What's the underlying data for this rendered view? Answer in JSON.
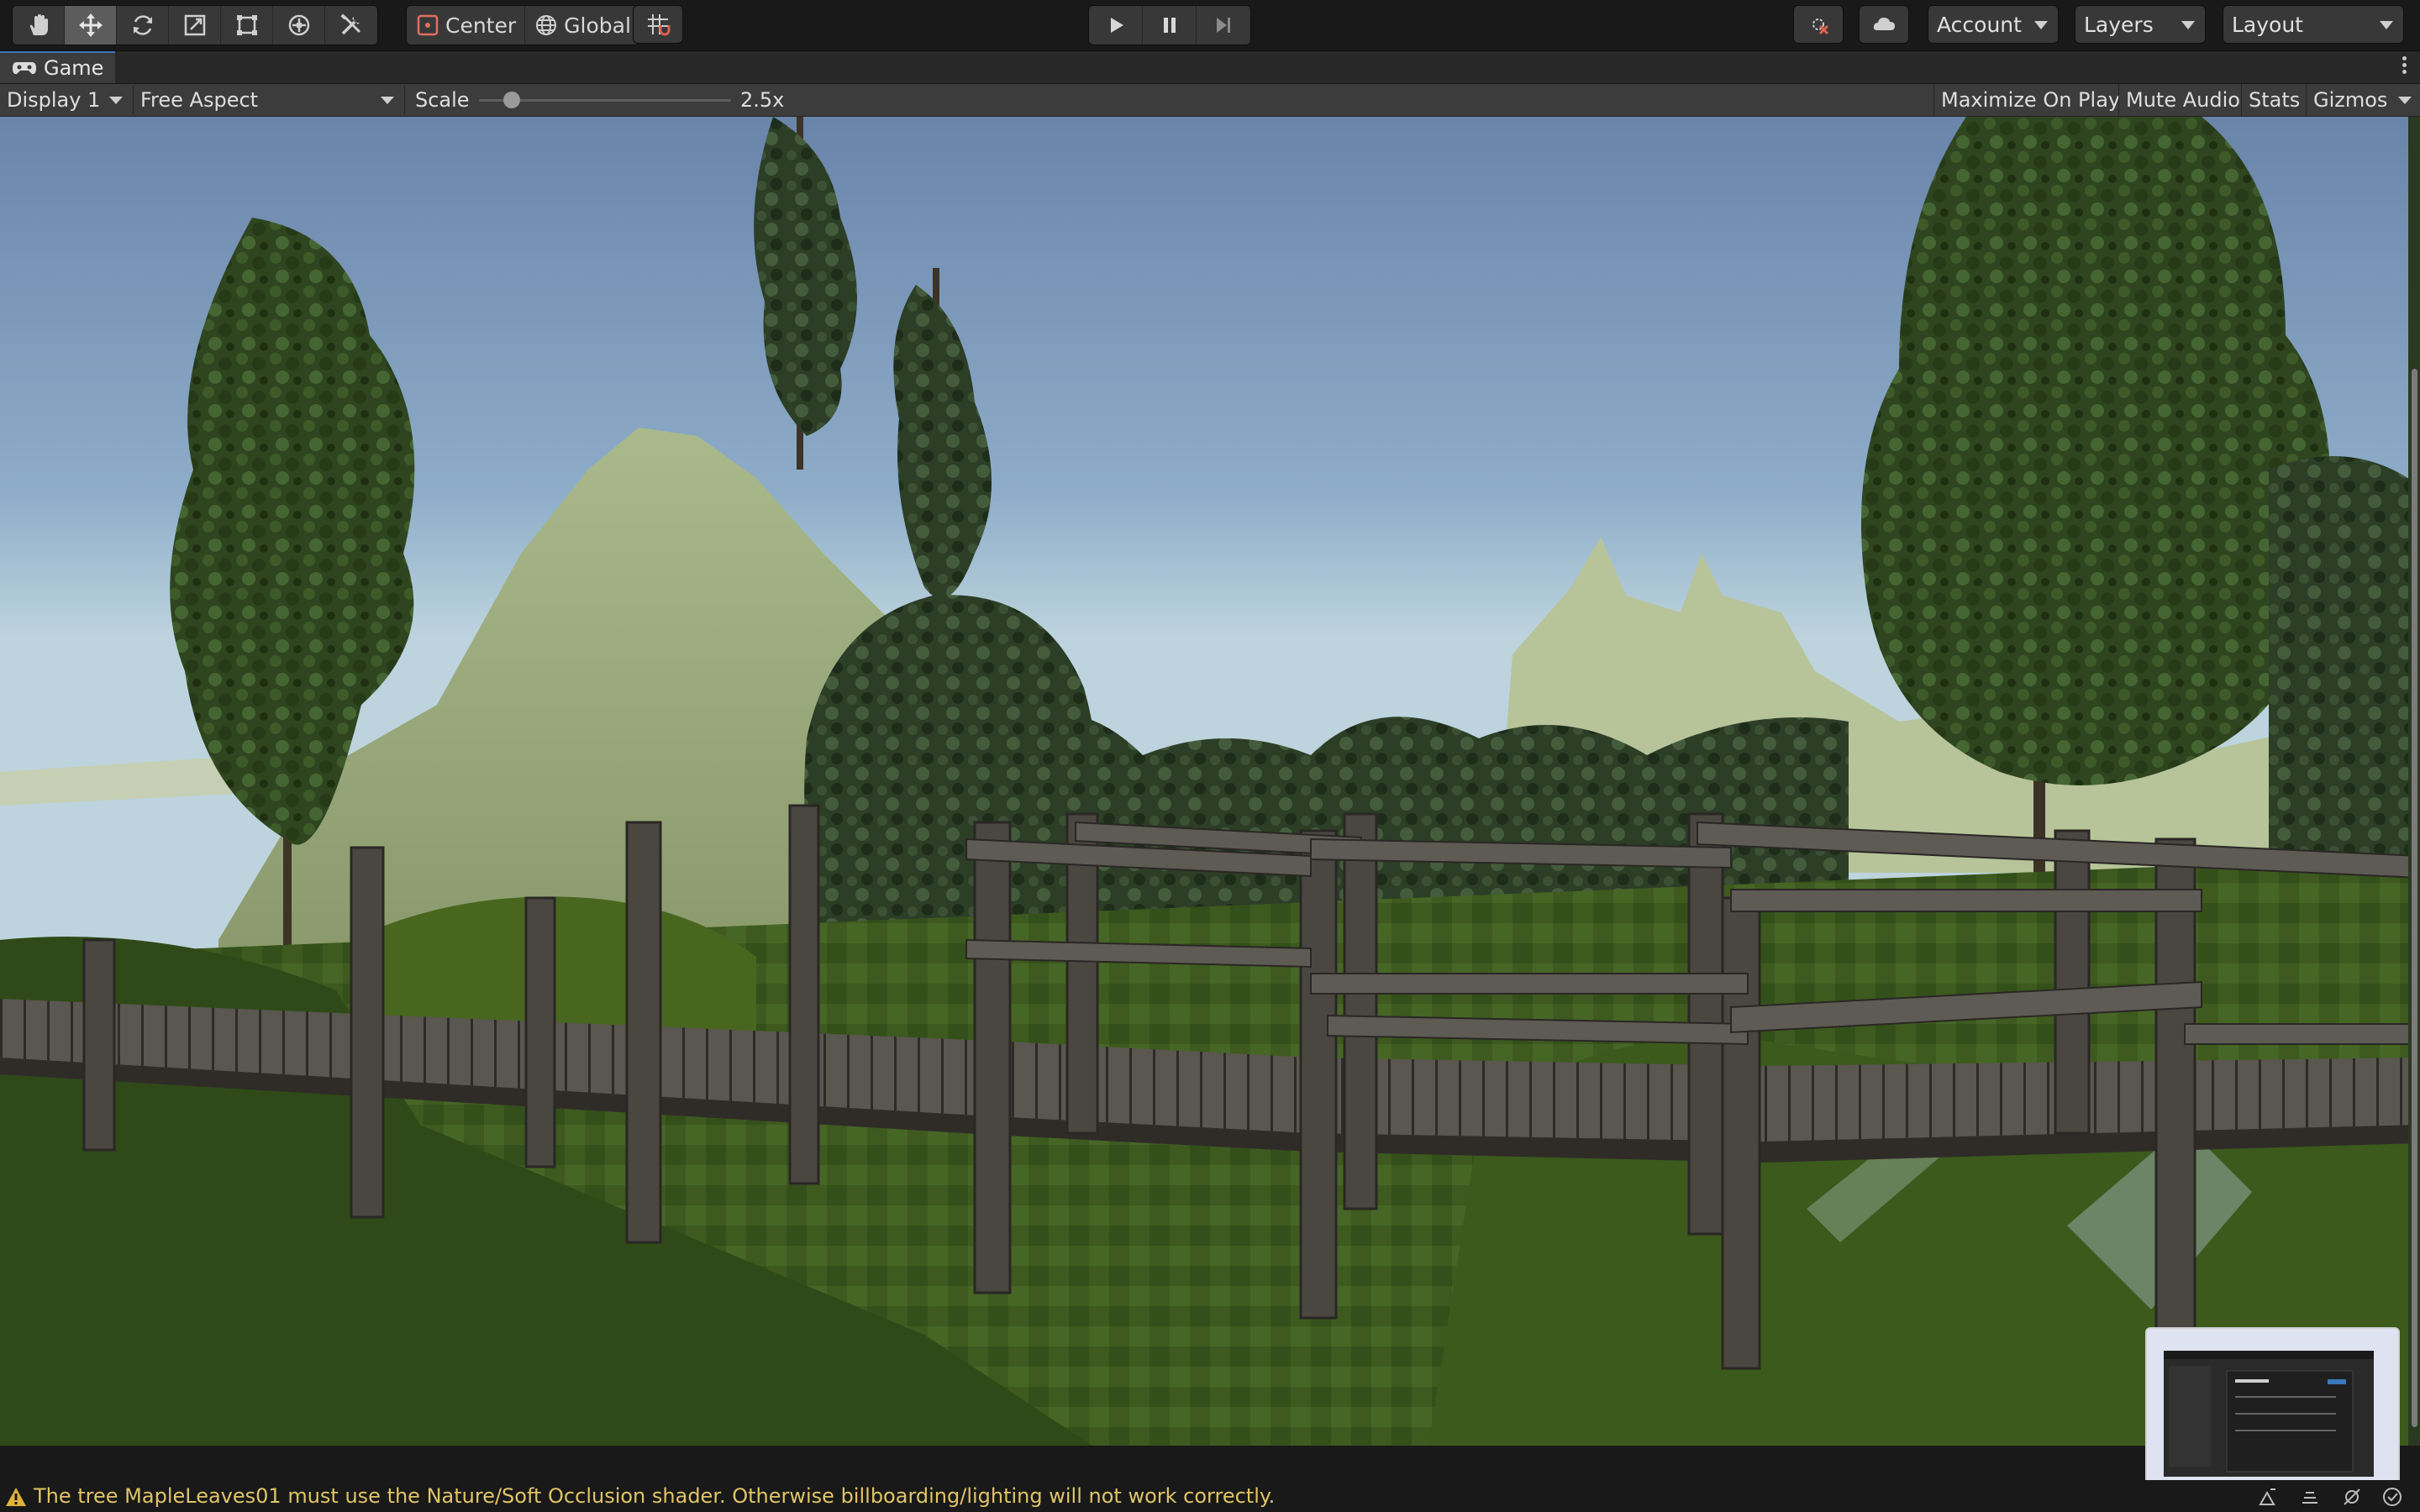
{
  "toolbar": {
    "tools": [
      {
        "name": "hand-tool",
        "icon": "hand-icon",
        "active": false
      },
      {
        "name": "move-tool",
        "icon": "move-icon",
        "active": true
      },
      {
        "name": "rotate-tool",
        "icon": "rotate-icon",
        "active": false
      },
      {
        "name": "scale-tool",
        "icon": "scale-icon",
        "active": false
      },
      {
        "name": "rect-tool",
        "icon": "rect-icon",
        "active": false
      },
      {
        "name": "transform-tool",
        "icon": "transform-icon",
        "active": false
      },
      {
        "name": "custom-tool",
        "icon": "tools-icon",
        "active": false
      }
    ],
    "pivot_label": "Center",
    "space_label": "Global",
    "account_label": "Account",
    "layers_label": "Layers",
    "layout_label": "Layout"
  },
  "tab": {
    "title": "Game"
  },
  "gamebar": {
    "display": "Display 1",
    "aspect": "Free Aspect",
    "scale_label": "Scale",
    "scale_value": "2.5x",
    "scale_fraction": 0.13,
    "maximize_label": "Maximize On Play",
    "mute_label": "Mute Audio",
    "stats_label": "Stats",
    "gizmos_label": "Gizmos"
  },
  "status": {
    "message": "The tree MapleLeaves01 must use the Nature/Soft Occlusion shader. Otherwise billboarding/lighting will not work correctly."
  },
  "colors": {
    "toolbar_bg": "#191919",
    "panel_bg": "#3c3c3c",
    "accent": "#3a79bb",
    "warning": "#e0c466",
    "sky_top": "#6a84aa",
    "sky_bottom": "#b9d2df",
    "grass": "#3e5a1f",
    "wood": "#4a4640"
  }
}
